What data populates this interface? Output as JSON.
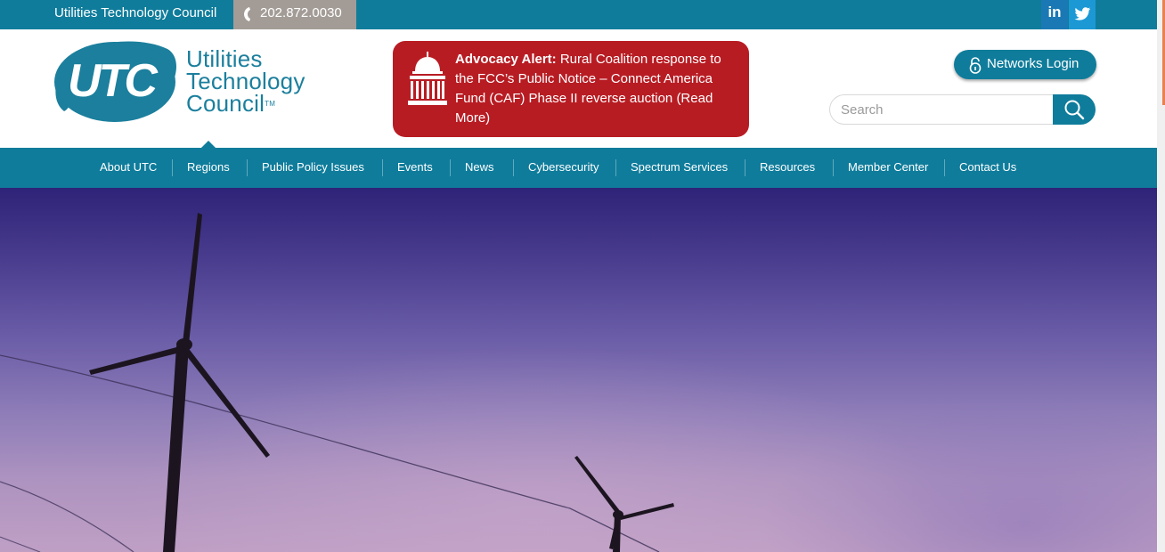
{
  "topbar": {
    "org_name": "Utilities Technology Council",
    "phone": "202.872.0030",
    "social": [
      {
        "name": "linkedin-icon",
        "glyph": "in"
      },
      {
        "name": "twitter-icon",
        "glyph": ""
      }
    ]
  },
  "logo": {
    "mark_text": "UTC",
    "line1": "Utilities",
    "line2": "Technology",
    "line3": "Council",
    "trademark": "TM"
  },
  "alert": {
    "lead": "Advocacy Alert:",
    "text": " Rural Coalition response to the FCC’s Public Notice – Connect America Fund (CAF) Phase II reverse auction (Read More)",
    "icon": "capitol-icon"
  },
  "login": {
    "label": "Networks Login",
    "icon": "lock-icon"
  },
  "search": {
    "placeholder": "Search",
    "value": "",
    "icon": "search-icon"
  },
  "nav": {
    "items": [
      {
        "label": "About UTC"
      },
      {
        "label": "Regions"
      },
      {
        "label": "Public Policy Issues"
      },
      {
        "label": "Events"
      },
      {
        "label": "News"
      },
      {
        "label": "Cybersecurity"
      },
      {
        "label": "Spectrum Services"
      },
      {
        "label": "Resources"
      },
      {
        "label": "Member Center"
      },
      {
        "label": "Contact Us"
      }
    ],
    "active": "Regions"
  },
  "colors": {
    "brand_teal": "#0f7c9b",
    "alert_red": "#b81c23",
    "phone_bg": "#a39c96",
    "linkedin": "#1a79b4",
    "twitter": "#1c98d4"
  }
}
